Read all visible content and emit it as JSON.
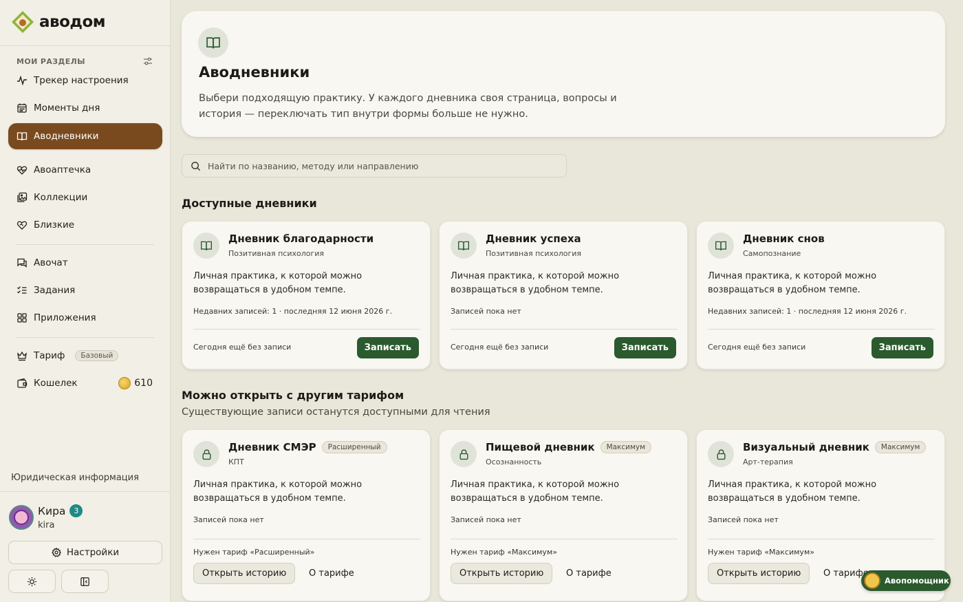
{
  "brand": {
    "name": "аводом"
  },
  "sidebar": {
    "section_label": "МОИ РАЗДЕЛЫ",
    "items": [
      {
        "label": "Трекер настроения",
        "icon": "activity-icon"
      },
      {
        "label": "Моменты дня",
        "icon": "calendar-icon"
      },
      {
        "label": "Аводневники",
        "icon": "book-icon",
        "active": true
      },
      {
        "label": "Авоаптечка",
        "icon": "heart-pulse-icon"
      },
      {
        "label": "Коллекции",
        "icon": "collection-icon"
      },
      {
        "label": "Близкие",
        "icon": "handshake-heart-icon"
      },
      {
        "label": "Авочат",
        "icon": "chat-icon"
      },
      {
        "label": "Задания",
        "icon": "tasks-icon"
      },
      {
        "label": "Приложения",
        "icon": "apps-icon"
      },
      {
        "label": "Тариф",
        "icon": "crown-icon",
        "badge": "Базовый"
      },
      {
        "label": "Кошелек",
        "icon": "wallet-icon",
        "value": "610"
      }
    ],
    "legal": "Юридическая информация",
    "user": {
      "name": "Кира",
      "level": "3",
      "login": "kira"
    },
    "settings_label": "Настройки"
  },
  "hero": {
    "title": "Аводневники",
    "description": "Выбери подходящую практику. У каждого дневника своя страница, вопросы и история — переключать тип внутри формы больше не нужно."
  },
  "search": {
    "placeholder": "Найти по названию, методу или направлению"
  },
  "available": {
    "heading": "Доступные дневники",
    "cards": [
      {
        "title": "Дневник благодарности",
        "category": "Позитивная психология",
        "description": "Личная практика, к которой можно возвращаться в удобном темпе.",
        "stats": "Недавних записей: 1 · последняя 12 июня 2026 г.",
        "today": "Сегодня ещё без записи",
        "action": "Записать"
      },
      {
        "title": "Дневник успеха",
        "category": "Позитивная психология",
        "description": "Личная практика, к которой можно возвращаться в удобном темпе.",
        "stats": "Записей пока нет",
        "today": "Сегодня ещё без записи",
        "action": "Записать"
      },
      {
        "title": "Дневник снов",
        "category": "Самопознание",
        "description": "Личная практика, к которой можно возвращаться в удобном темпе.",
        "stats": "Недавних записей: 1 · последняя 12 июня 2026 г.",
        "today": "Сегодня ещё без записи",
        "action": "Записать"
      }
    ]
  },
  "locked": {
    "heading": "Можно открыть с другим тарифом",
    "subheading": "Существующие записи останутся доступными для чтения",
    "cards": [
      {
        "title": "Дневник СМЭР",
        "tier": "Расширенный",
        "category": "КПТ",
        "description": "Личная практика, к которой можно возвращаться в удобном темпе.",
        "stats": "Записей пока нет",
        "need": "Нужен тариф «Расширенный»",
        "history": "Открыть историю",
        "about": "О тарифе"
      },
      {
        "title": "Пищевой дневник",
        "tier": "Максимум",
        "category": "Осознанность",
        "description": "Личная практика, к которой можно возвращаться в удобном темпе.",
        "stats": "Записей пока нет",
        "need": "Нужен тариф «Максимум»",
        "history": "Открыть историю",
        "about": "О тарифе"
      },
      {
        "title": "Визуальный дневник",
        "tier": "Максимум",
        "category": "Арт-терапия",
        "description": "Личная практика, к которой можно возвращаться в удобном темпе.",
        "stats": "Записей пока нет",
        "need": "Нужен тариф «Максимум»",
        "history": "Открыть историю",
        "about": "О тарифе"
      }
    ]
  },
  "assistant": {
    "label": "Авопомощник"
  },
  "colors": {
    "accent": "#7a4a1f",
    "primary_button": "#2a5a2e",
    "background": "#e9e6da",
    "card": "#f8f7f2"
  }
}
